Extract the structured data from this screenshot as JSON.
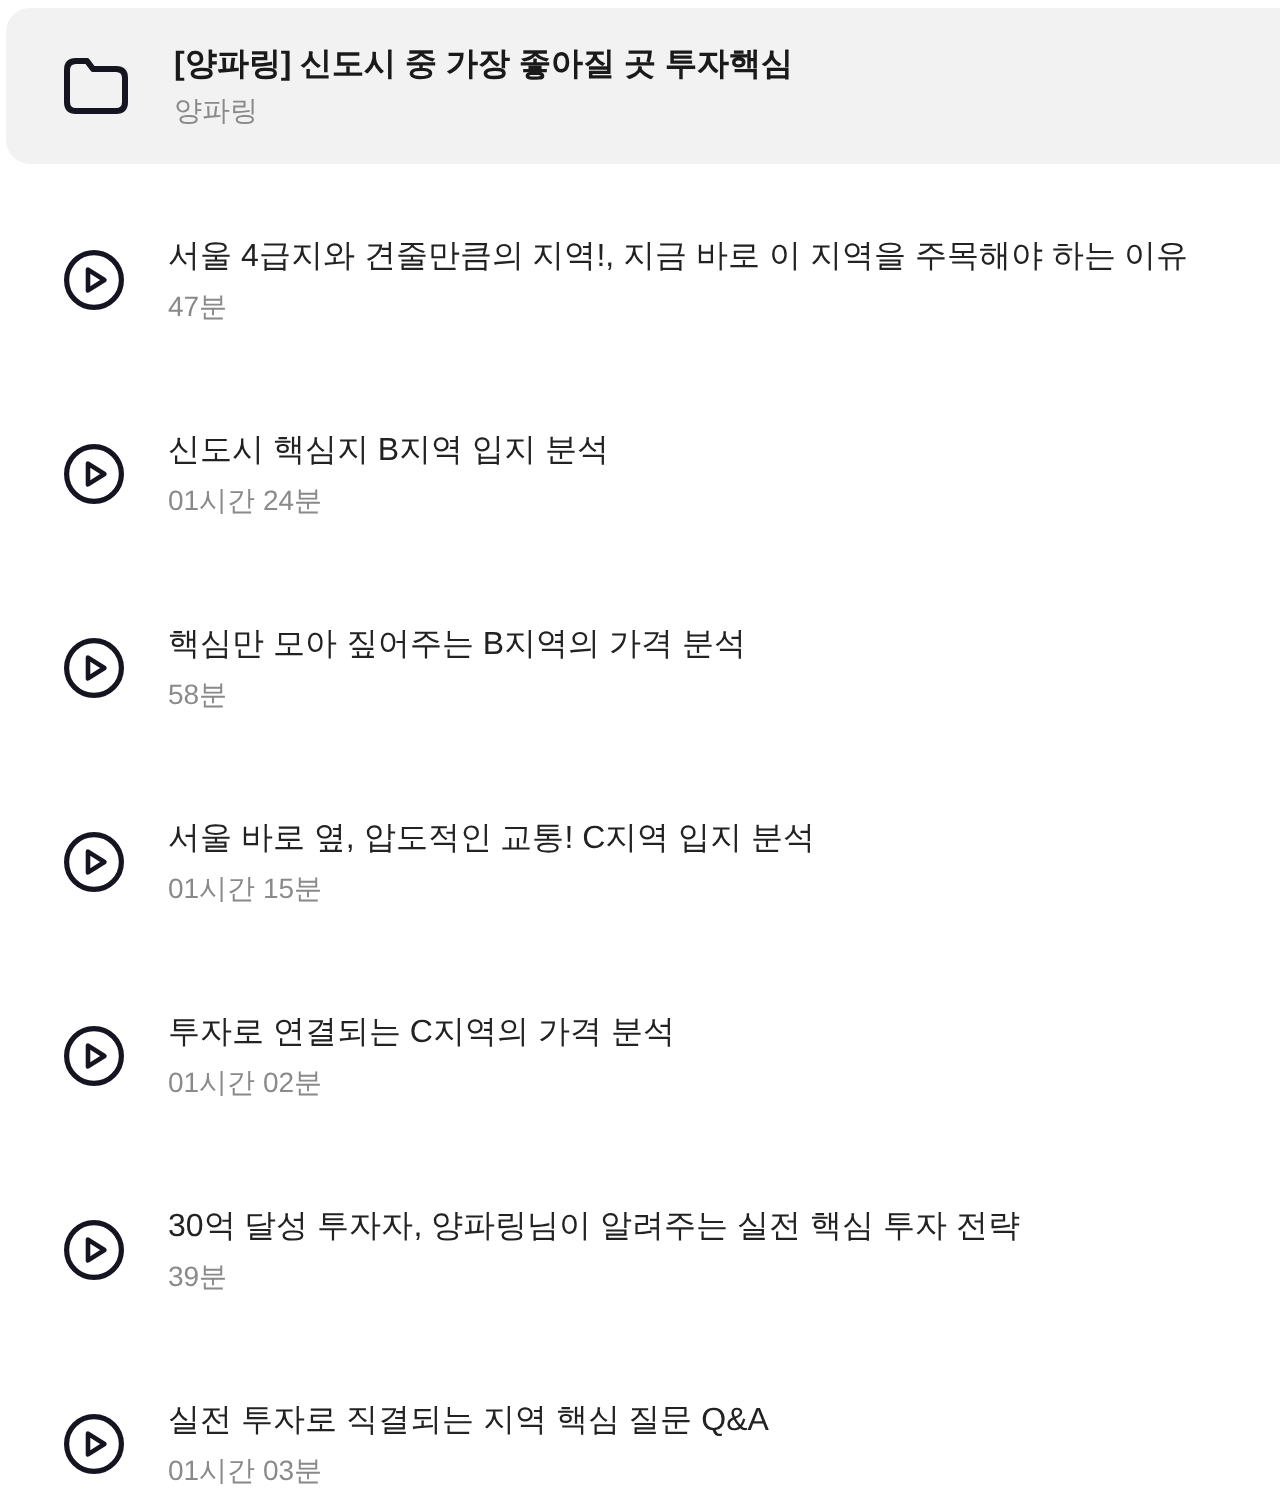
{
  "folder": {
    "title": "[양파링] 신도시 중 가장 좋아질 곳 투자핵심",
    "author": "양파링"
  },
  "lessons": [
    {
      "title": "서울 4급지와 견줄만큼의 지역!, 지금 바로 이 지역을 주목해야 하는 이유",
      "duration": "47분"
    },
    {
      "title": "신도시 핵심지 B지역 입지 분석",
      "duration": "01시간 24분"
    },
    {
      "title": "핵심만 모아 짚어주는 B지역의 가격 분석",
      "duration": "58분"
    },
    {
      "title": "서울 바로 옆, 압도적인 교통! C지역 입지 분석",
      "duration": "01시간 15분"
    },
    {
      "title": "투자로 연결되는 C지역의 가격 분석",
      "duration": "01시간 02분"
    },
    {
      "title": "30억 달성 투자자, 양파링님이 알려주는 실전 핵심 투자 전략",
      "duration": "39분"
    },
    {
      "title": "실전 투자로 직결되는 지역 핵심 질문 Q&A",
      "duration": "01시간 03분"
    }
  ]
}
